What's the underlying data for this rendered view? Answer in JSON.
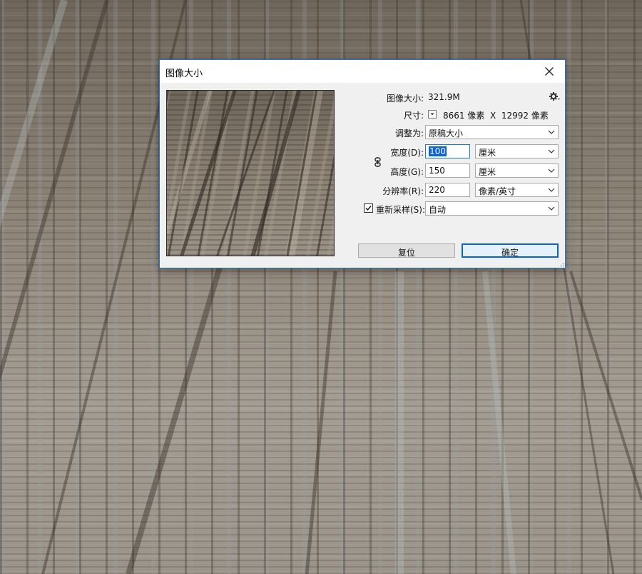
{
  "dialog": {
    "title": "图像大小",
    "close_icon": "close-icon",
    "image_size_label": "图像大小:",
    "image_size_value": "321.9M",
    "settings_icon": "gear-icon",
    "dimensions_label": "尺寸:",
    "dimensions_dropdown_icon": "chevron-down-icon",
    "dimensions_value": "8661 像素  X  12992 像素",
    "fit_to": {
      "label": "调整为:",
      "value": "原稿大小"
    },
    "width": {
      "label": "宽度(D):",
      "value": "100",
      "unit": "厘米"
    },
    "height": {
      "label": "高度(G):",
      "value": "150",
      "unit": "厘米"
    },
    "resolution": {
      "label": "分辨率(R):",
      "value": "220",
      "unit": "像素/英寸"
    },
    "constrain_icon": "link-icon",
    "resample": {
      "label": "重新采样(S):",
      "checked": true,
      "value": "自动"
    },
    "reset_button": "复位",
    "ok_button": "确定"
  },
  "colors": {
    "dialog_bg": "#f0f0f0",
    "accent": "#0a64d6",
    "border_focus": "#1f79c8"
  }
}
